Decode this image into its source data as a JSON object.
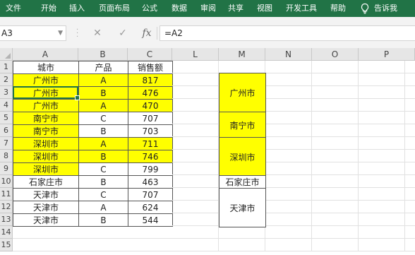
{
  "ribbon": {
    "tabs": [
      "文件",
      "开始",
      "插入",
      "页面布局",
      "公式",
      "数据",
      "审阅",
      "共享",
      "视图",
      "开发工具",
      "帮助"
    ],
    "tell_me": "告诉我"
  },
  "formula_bar": {
    "name_box": "A3",
    "cancel_glyph": "✕",
    "enter_glyph": "✓",
    "fx_label": "fx",
    "formula": "=A2"
  },
  "columns": [
    "A",
    "B",
    "C",
    "L",
    "M",
    "N",
    "O",
    "P"
  ],
  "rows": [
    "1",
    "2",
    "3",
    "4",
    "5",
    "6",
    "7",
    "8",
    "9",
    "10",
    "11",
    "12",
    "13",
    "14",
    "15"
  ],
  "table": {
    "headers": [
      "城市",
      "产品",
      "销售额"
    ],
    "rows": [
      [
        "广州市",
        "A",
        "817"
      ],
      [
        "广州市",
        "B",
        "476"
      ],
      [
        "广州市",
        "A",
        "470"
      ],
      [
        "南宁市",
        "C",
        "707"
      ],
      [
        "南宁市",
        "B",
        "703"
      ],
      [
        "深圳市",
        "A",
        "711"
      ],
      [
        "深圳市",
        "B",
        "746"
      ],
      [
        "深圳市",
        "C",
        "799"
      ],
      [
        "石家庄市",
        "B",
        "463"
      ],
      [
        "天津市",
        "C",
        "707"
      ],
      [
        "天津市",
        "A",
        "624"
      ],
      [
        "天津市",
        "B",
        "544"
      ]
    ]
  },
  "merged_cities": [
    "广州市",
    "南宁市",
    "深圳市",
    "石家庄市",
    "天津市"
  ],
  "colors": {
    "ribbon": "#217346",
    "highlight": "#ffff00",
    "selection": "#217346"
  }
}
